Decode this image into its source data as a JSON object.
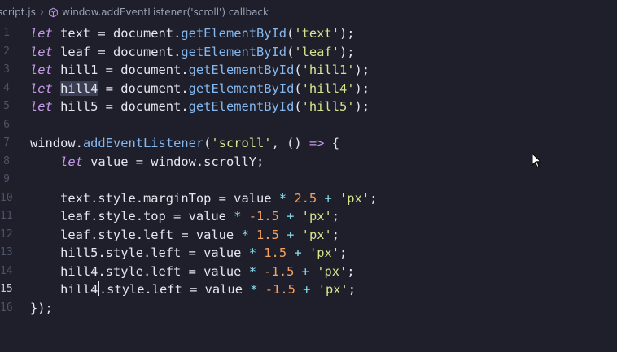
{
  "breadcrumb": {
    "file": "script.js",
    "separator": "›",
    "symbol": "window.addEventListener('scroll') callback"
  },
  "editor": {
    "active_line": 15,
    "lines": [
      {
        "num": "1",
        "tokens": [
          {
            "t": "let",
            "c": "kw"
          },
          {
            "t": " text = document."
          },
          {
            "t": "getElementById",
            "c": "fn"
          },
          {
            "t": "("
          },
          {
            "t": "'text'",
            "c": "str"
          },
          {
            "t": ");"
          }
        ]
      },
      {
        "num": "2",
        "tokens": [
          {
            "t": "let",
            "c": "kw"
          },
          {
            "t": " leaf = document."
          },
          {
            "t": "getElementById",
            "c": "fn"
          },
          {
            "t": "("
          },
          {
            "t": "'leaf'",
            "c": "str"
          },
          {
            "t": ");"
          }
        ]
      },
      {
        "num": "3",
        "tokens": [
          {
            "t": "let",
            "c": "kw"
          },
          {
            "t": " hill1 = document."
          },
          {
            "t": "getElementById",
            "c": "fn"
          },
          {
            "t": "("
          },
          {
            "t": "'hill1'",
            "c": "str"
          },
          {
            "t": ");"
          }
        ]
      },
      {
        "num": "4",
        "tokens": [
          {
            "t": "let",
            "c": "kw"
          },
          {
            "t": " "
          },
          {
            "t": "hill4",
            "c": "sel"
          },
          {
            "t": " = document."
          },
          {
            "t": "getElementById",
            "c": "fn"
          },
          {
            "t": "("
          },
          {
            "t": "'hill4'",
            "c": "str"
          },
          {
            "t": ");"
          }
        ]
      },
      {
        "num": "5",
        "tokens": [
          {
            "t": "let",
            "c": "kw"
          },
          {
            "t": " hill5 = document."
          },
          {
            "t": "getElementById",
            "c": "fn"
          },
          {
            "t": "("
          },
          {
            "t": "'hill5'",
            "c": "str"
          },
          {
            "t": ");"
          }
        ]
      },
      {
        "num": "6",
        "tokens": []
      },
      {
        "num": "7",
        "tokens": [
          {
            "t": "window."
          },
          {
            "t": "addEventListener",
            "c": "fn"
          },
          {
            "t": "("
          },
          {
            "t": "'scroll'",
            "c": "str"
          },
          {
            "t": ", () "
          },
          {
            "t": "=>",
            "c": "kw"
          },
          {
            "t": " {"
          }
        ]
      },
      {
        "num": "8",
        "tokens": [
          {
            "t": "    "
          },
          {
            "t": "let",
            "c": "kw"
          },
          {
            "t": " value = window.scrollY;"
          }
        ]
      },
      {
        "num": "9",
        "tokens": []
      },
      {
        "num": "10",
        "tokens": [
          {
            "t": "    text.style.marginTop = value "
          },
          {
            "t": "*",
            "c": "op"
          },
          {
            "t": " "
          },
          {
            "t": "2.5",
            "c": "num"
          },
          {
            "t": " "
          },
          {
            "t": "+",
            "c": "op"
          },
          {
            "t": " "
          },
          {
            "t": "'px'",
            "c": "str"
          },
          {
            "t": ";"
          }
        ]
      },
      {
        "num": "11",
        "tokens": [
          {
            "t": "    leaf.style.top = value "
          },
          {
            "t": "*",
            "c": "op"
          },
          {
            "t": " "
          },
          {
            "t": "-1.5",
            "c": "num"
          },
          {
            "t": " "
          },
          {
            "t": "+",
            "c": "op"
          },
          {
            "t": " "
          },
          {
            "t": "'px'",
            "c": "str"
          },
          {
            "t": ";"
          }
        ]
      },
      {
        "num": "12",
        "tokens": [
          {
            "t": "    leaf.style.left = value "
          },
          {
            "t": "*",
            "c": "op"
          },
          {
            "t": " "
          },
          {
            "t": "1.5",
            "c": "num"
          },
          {
            "t": " "
          },
          {
            "t": "+",
            "c": "op"
          },
          {
            "t": " "
          },
          {
            "t": "'px'",
            "c": "str"
          },
          {
            "t": ";"
          }
        ]
      },
      {
        "num": "13",
        "tokens": [
          {
            "t": "    hill5.style.left = value "
          },
          {
            "t": "*",
            "c": "op"
          },
          {
            "t": " "
          },
          {
            "t": "1.5",
            "c": "num"
          },
          {
            "t": " "
          },
          {
            "t": "+",
            "c": "op"
          },
          {
            "t": " "
          },
          {
            "t": "'px'",
            "c": "str"
          },
          {
            "t": ";"
          }
        ]
      },
      {
        "num": "14",
        "tokens": [
          {
            "t": "    hill4.style.left = value "
          },
          {
            "t": "*",
            "c": "op"
          },
          {
            "t": " "
          },
          {
            "t": "-1.5",
            "c": "num"
          },
          {
            "t": " "
          },
          {
            "t": "+",
            "c": "op"
          },
          {
            "t": " "
          },
          {
            "t": "'px'",
            "c": "str"
          },
          {
            "t": ";"
          }
        ]
      },
      {
        "num": "15",
        "tokens": [
          {
            "t": "    hill4"
          },
          {
            "t": "",
            "c": "cursor"
          },
          {
            "t": ".style.left = value "
          },
          {
            "t": "*",
            "c": "op"
          },
          {
            "t": " "
          },
          {
            "t": "-1.5",
            "c": "num"
          },
          {
            "t": " "
          },
          {
            "t": "+",
            "c": "op"
          },
          {
            "t": " "
          },
          {
            "t": "'px'",
            "c": "str"
          },
          {
            "t": ";"
          }
        ]
      },
      {
        "num": "16",
        "tokens": [
          {
            "t": "});"
          }
        ]
      }
    ]
  },
  "colors": {
    "background": "#1e1f2b",
    "keyword": "#c79ae8",
    "function": "#86b8f0",
    "string": "#d7e68e",
    "number": "#f7a25c",
    "text": "#e6e6ee"
  },
  "icons": {
    "breadcrumb_symbol": "cube-icon",
    "pointer": "mouse-pointer-icon"
  }
}
